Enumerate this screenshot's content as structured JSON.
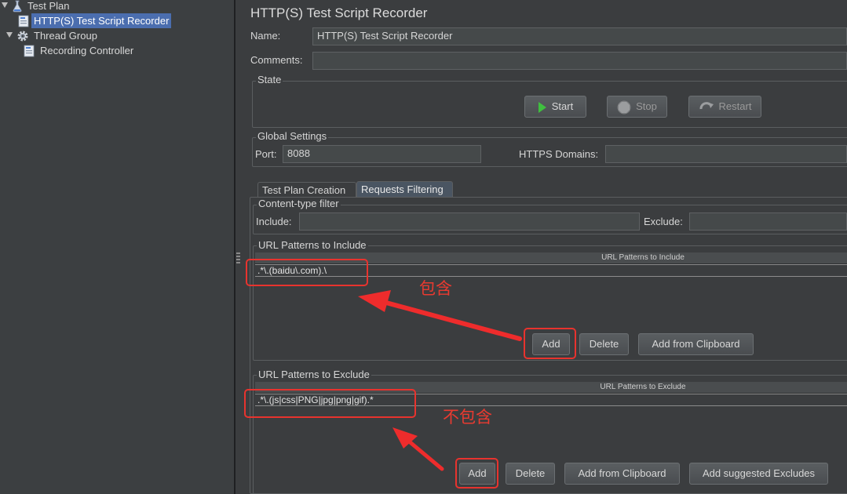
{
  "tree": {
    "items": [
      {
        "label": "Test Plan",
        "icon": "flask-icon"
      },
      {
        "label": "HTTP(S) Test Script Recorder",
        "icon": "recorder-icon",
        "selected": true
      },
      {
        "label": "Thread Group",
        "icon": "gear-icon"
      },
      {
        "label": "Recording Controller",
        "icon": "controller-icon"
      }
    ]
  },
  "panel": {
    "title": "HTTP(S) Test Script Recorder",
    "name_label": "Name:",
    "name_value": "HTTP(S) Test Script Recorder",
    "comments_label": "Comments:",
    "comments_value": ""
  },
  "state": {
    "title": "State",
    "start_label": "Start",
    "stop_label": "Stop",
    "restart_label": "Restart"
  },
  "global_settings": {
    "title": "Global Settings",
    "port_label": "Port:",
    "port_value": "8088",
    "https_label": "HTTPS Domains:",
    "https_value": ""
  },
  "tabs": [
    {
      "label": "Test Plan Creation",
      "active": false
    },
    {
      "label": "Requests Filtering",
      "active": true
    }
  ],
  "content_type": {
    "title": "Content-type filter",
    "include_label": "Include:",
    "include_value": "",
    "exclude_label": "Exclude:",
    "exclude_value": ""
  },
  "url_include": {
    "title": "URL Patterns to Include",
    "column_header": "URL Patterns to Include",
    "rows": [
      ".*\\.(baidu\\.com).\\"
    ],
    "add_label": "Add",
    "delete_label": "Delete",
    "clipboard_label": "Add from Clipboard"
  },
  "url_exclude": {
    "title": "URL Patterns to Exclude",
    "column_header": "URL Patterns to Exclude",
    "rows": [
      ".*\\.(js|css|PNG|jpg|png|gif).*"
    ],
    "add_label": "Add",
    "delete_label": "Delete",
    "clipboard_label": "Add from Clipboard",
    "suggested_label": "Add suggested Excludes"
  },
  "annotations": {
    "include_note": "包含",
    "exclude_note": "不包含",
    "color": "#e8332e"
  },
  "colors": {
    "background": "#3b3d3f",
    "selection": "#4b6eaf",
    "start_arrow": "#3fbf3f"
  }
}
